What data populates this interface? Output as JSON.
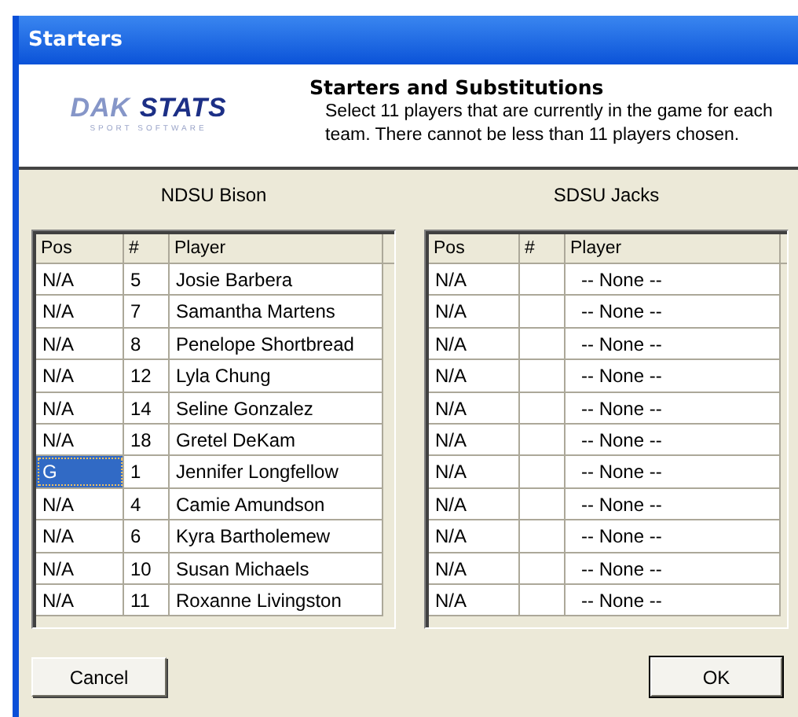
{
  "window": {
    "title": "Starters"
  },
  "header": {
    "logo": {
      "word_1": "DAK",
      "word_2": "STATS",
      "tagline": "SPORT SOFTWARE"
    },
    "heading": "Starters and Substitutions",
    "description": "Select 11 players that are currently in the game for each team. There cannot be less than 11 players chosen."
  },
  "teams": [
    {
      "name": "NDSU Bison",
      "columns": [
        "Pos",
        "#",
        "Player"
      ],
      "rows": [
        {
          "pos": "N/A",
          "number": "5",
          "player": "Josie Barbera",
          "selected": false
        },
        {
          "pos": "N/A",
          "number": "7",
          "player": "Samantha Martens",
          "selected": false
        },
        {
          "pos": "N/A",
          "number": "8",
          "player": "Penelope Shortbread",
          "selected": false
        },
        {
          "pos": "N/A",
          "number": "12",
          "player": "Lyla Chung",
          "selected": false
        },
        {
          "pos": "N/A",
          "number": "14",
          "player": "Seline Gonzalez",
          "selected": false
        },
        {
          "pos": "N/A",
          "number": "18",
          "player": "Gretel DeKam",
          "selected": false
        },
        {
          "pos": "G",
          "number": "1",
          "player": "Jennifer Longfellow",
          "selected": true
        },
        {
          "pos": "N/A",
          "number": "4",
          "player": "Camie Amundson",
          "selected": false
        },
        {
          "pos": "N/A",
          "number": "6",
          "player": "Kyra Bartholemew",
          "selected": false
        },
        {
          "pos": "N/A",
          "number": "10",
          "player": "Susan Michaels",
          "selected": false
        },
        {
          "pos": "N/A",
          "number": "11",
          "player": "Roxanne Livingston",
          "selected": false
        }
      ]
    },
    {
      "name": "SDSU Jacks",
      "columns": [
        "Pos",
        "#",
        "Player"
      ],
      "rows": [
        {
          "pos": "N/A",
          "player": "-- None --",
          "selected": false
        },
        {
          "pos": "N/A",
          "player": "-- None --",
          "selected": false
        },
        {
          "pos": "N/A",
          "player": "-- None --",
          "selected": false
        },
        {
          "pos": "N/A",
          "player": "-- None --",
          "selected": false
        },
        {
          "pos": "N/A",
          "player": "-- None --",
          "selected": false
        },
        {
          "pos": "N/A",
          "player": "-- None --",
          "selected": false
        },
        {
          "pos": "N/A",
          "player": "-- None --",
          "selected": false
        },
        {
          "pos": "N/A",
          "player": "-- None --",
          "selected": false
        },
        {
          "pos": "N/A",
          "player": "-- None --",
          "selected": false
        },
        {
          "pos": "N/A",
          "player": "-- None --",
          "selected": false
        },
        {
          "pos": "N/A",
          "player": "-- None --",
          "selected": false
        }
      ]
    }
  ],
  "buttons": [
    {
      "label": "Cancel",
      "kind": "cancel"
    },
    {
      "label": "OK",
      "kind": "ok"
    }
  ]
}
